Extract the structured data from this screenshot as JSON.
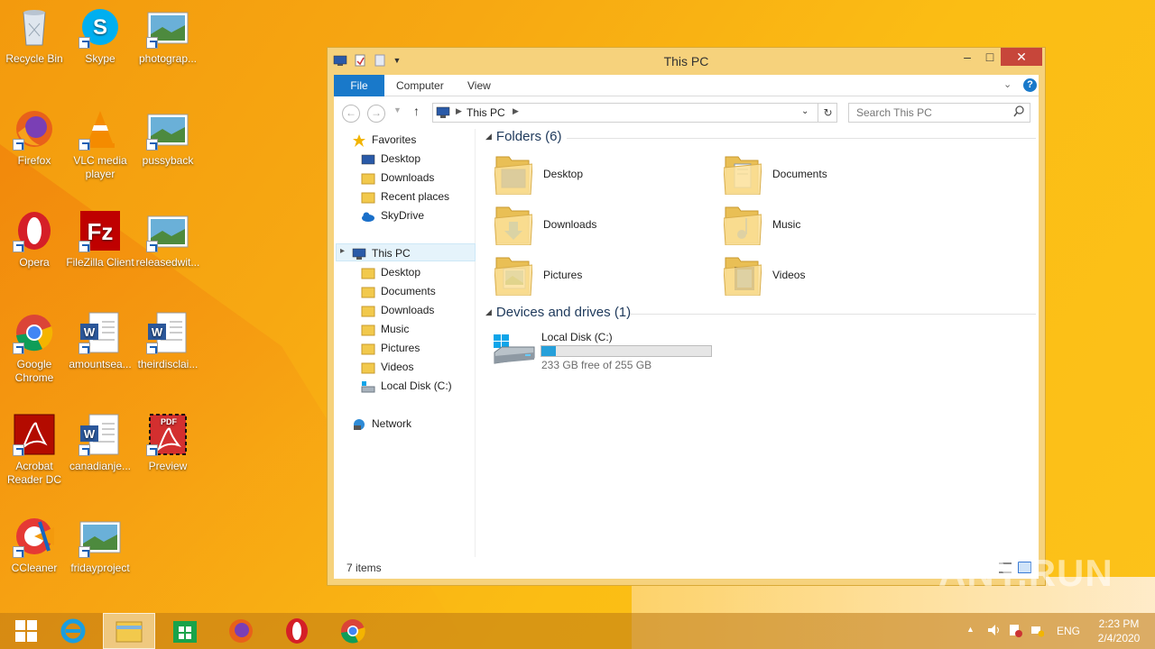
{
  "desktop": {
    "icons": [
      {
        "label": "Recycle Bin",
        "icon": "recycle-bin-icon"
      },
      {
        "label": "Skype",
        "icon": "skype-icon"
      },
      {
        "label": "photograp...",
        "icon": "image-file-icon"
      },
      {
        "label": "Firefox",
        "icon": "firefox-icon"
      },
      {
        "label": "VLC media player",
        "icon": "vlc-icon"
      },
      {
        "label": "pussyback",
        "icon": "image-file-icon"
      },
      {
        "label": "Opera",
        "icon": "opera-icon"
      },
      {
        "label": "FileZilla Client",
        "icon": "filezilla-icon"
      },
      {
        "label": "releasedwit...",
        "icon": "image-file-icon"
      },
      {
        "label": "Google Chrome",
        "icon": "chrome-icon"
      },
      {
        "label": "amountsea...",
        "icon": "word-doc-icon"
      },
      {
        "label": "theirdisclai...",
        "icon": "word-doc-icon"
      },
      {
        "label": "Acrobat Reader DC",
        "icon": "acrobat-icon"
      },
      {
        "label": "canadianje...",
        "icon": "word-doc-icon"
      },
      {
        "label": "Preview",
        "icon": "pdf-icon"
      },
      {
        "label": "CCleaner",
        "icon": "ccleaner-icon"
      },
      {
        "label": "fridayproject",
        "icon": "image-file-icon"
      }
    ]
  },
  "window": {
    "title": "This PC",
    "controls": {
      "minimize": "–",
      "maximize": "□",
      "close": "✕"
    },
    "ribbon_tabs": [
      "File",
      "Computer",
      "View"
    ],
    "address": "This PC",
    "search_placeholder": "Search This PC",
    "nav": {
      "favorites": "Favorites",
      "fav_items": [
        "Desktop",
        "Downloads",
        "Recent places",
        "SkyDrive"
      ],
      "this_pc": "This PC",
      "pc_items": [
        "Desktop",
        "Documents",
        "Downloads",
        "Music",
        "Pictures",
        "Videos",
        "Local Disk (C:)"
      ],
      "network": "Network"
    },
    "folders_header": "Folders (6)",
    "folders": [
      "Desktop",
      "Documents",
      "Downloads",
      "Music",
      "Pictures",
      "Videos"
    ],
    "devices_header": "Devices and drives (1)",
    "drive": {
      "name": "Local Disk (C:)",
      "free_text": "233 GB free of 255 GB",
      "used_fraction": 0.086
    },
    "status": "7 items"
  },
  "taskbar": {
    "apps": [
      "start-icon",
      "internet-explorer-icon",
      "file-explorer-icon",
      "store-icon",
      "firefox-icon",
      "opera-icon",
      "chrome-icon"
    ],
    "lang": "ENG",
    "time": "2:23 PM",
    "date": "2/4/2020"
  },
  "watermark": "ANY.RUN",
  "colors": {
    "accent": "#1979ca",
    "window_frame": "#f6d27c",
    "close": "#c7463a",
    "drive_bar": "#26a0da"
  }
}
